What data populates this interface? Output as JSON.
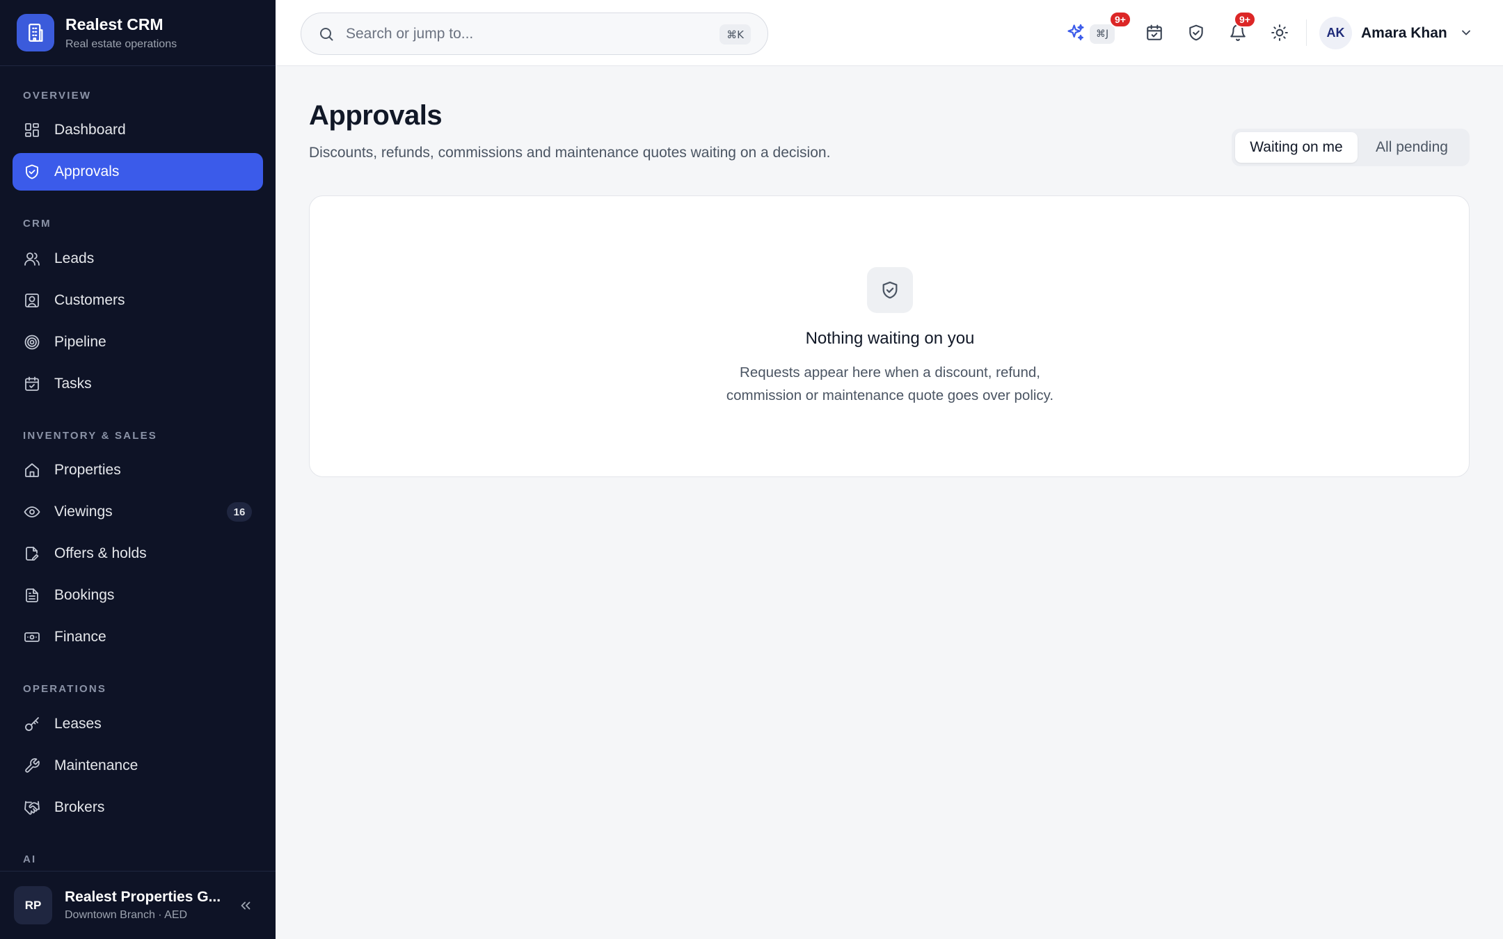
{
  "brand": {
    "title": "Realest CRM",
    "subtitle": "Real estate operations"
  },
  "sidebar": {
    "sections": [
      {
        "label": "OVERVIEW"
      },
      {
        "label": "CRM"
      },
      {
        "label": "INVENTORY & SALES"
      },
      {
        "label": "OPERATIONS"
      },
      {
        "label": "AI"
      }
    ],
    "items": [
      {
        "label": "Dashboard",
        "icon": "dashboard-icon"
      },
      {
        "label": "Approvals",
        "icon": "shield-check-icon",
        "active": true
      },
      {
        "label": "Leads",
        "icon": "users-icon"
      },
      {
        "label": "Customers",
        "icon": "contact-icon"
      },
      {
        "label": "Pipeline",
        "icon": "target-icon"
      },
      {
        "label": "Tasks",
        "icon": "calendar-check-icon"
      },
      {
        "label": "Properties",
        "icon": "home-icon"
      },
      {
        "label": "Viewings",
        "icon": "eye-icon",
        "badge": "16"
      },
      {
        "label": "Offers & holds",
        "icon": "file-edit-icon"
      },
      {
        "label": "Bookings",
        "icon": "file-text-icon"
      },
      {
        "label": "Finance",
        "icon": "banknote-icon"
      },
      {
        "label": "Leases",
        "icon": "key-icon"
      },
      {
        "label": "Maintenance",
        "icon": "wrench-icon"
      },
      {
        "label": "Brokers",
        "icon": "handshake-icon"
      }
    ],
    "footer": {
      "initials": "RP",
      "name": "Realest Properties G...",
      "sub": "Downtown Branch · AED"
    }
  },
  "topbar": {
    "search": {
      "placeholder": "Search or jump to...",
      "shortcut": "⌘K"
    },
    "ai_shortcut": "⌘J",
    "ai_badge": "9+",
    "notifications_badge": "9+",
    "user": {
      "initials": "AK",
      "name": "Amara Khan"
    }
  },
  "page": {
    "title": "Approvals",
    "subtitle": "Discounts, refunds, commissions and maintenance quotes waiting on a decision.",
    "tabs": [
      {
        "label": "Waiting on me",
        "active": true
      },
      {
        "label": "All pending",
        "active": false
      }
    ],
    "empty": {
      "title": "Nothing waiting on you",
      "line1": "Requests appear here when a discount, refund,",
      "line2": "commission or maintenance quote goes over policy."
    }
  },
  "colors": {
    "accent": "#3b5bea",
    "sidebar_bg": "#0e1326",
    "badge_red": "#dc2626"
  }
}
